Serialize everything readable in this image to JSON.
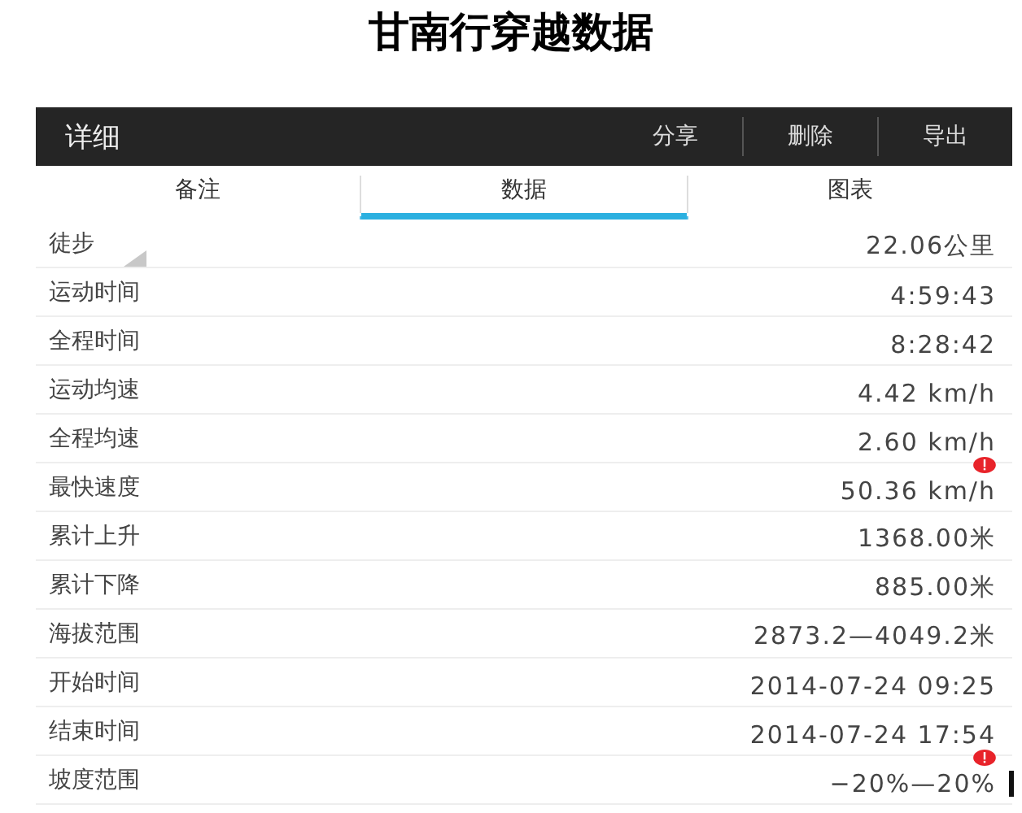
{
  "page_title": "甘南行穿越数据",
  "app_bar": {
    "title": "详细",
    "actions": [
      "分享",
      "删除",
      "导出"
    ]
  },
  "tabs": [
    {
      "label": "备注",
      "selected": false
    },
    {
      "label": "数据",
      "selected": true
    },
    {
      "label": "图表",
      "selected": false
    }
  ],
  "rows": [
    {
      "kind": "selector",
      "label": "徒步",
      "value": "22.06公里",
      "alert": false
    },
    {
      "kind": "value",
      "label": "运动时间",
      "value": "4:59:43",
      "alert": false
    },
    {
      "kind": "value",
      "label": "全程时间",
      "value": "8:28:42",
      "alert": false
    },
    {
      "kind": "value",
      "label": "运动均速",
      "value": "4.42 km/h",
      "alert": false
    },
    {
      "kind": "value",
      "label": "全程均速",
      "value": "2.60 km/h",
      "alert": false
    },
    {
      "kind": "value",
      "label": "最快速度",
      "value": "50.36 km/h",
      "alert": true
    },
    {
      "kind": "value",
      "label": "累计上升",
      "value": "1368.00米",
      "alert": false
    },
    {
      "kind": "value",
      "label": "累计下降",
      "value": "885.00米",
      "alert": false
    },
    {
      "kind": "value",
      "label": "海拔范围",
      "value": "2873.2—4049.2米",
      "alert": false
    },
    {
      "kind": "value",
      "label": "开始时间",
      "value": "2014-07-24 09:25",
      "alert": false
    },
    {
      "kind": "value",
      "label": "结束时间",
      "value": "2014-07-24 17:54",
      "alert": false
    },
    {
      "kind": "value",
      "label": "坡度范围",
      "value": "−20%—20%",
      "alert": true
    }
  ]
}
